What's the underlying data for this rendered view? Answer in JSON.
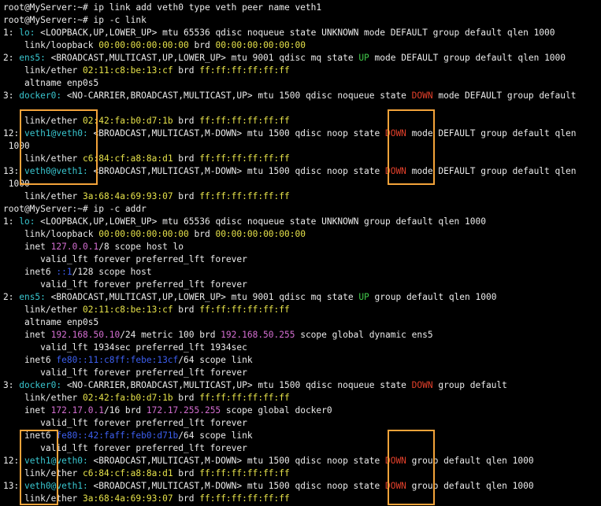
{
  "colors": {
    "background": "#000000",
    "text": "#ebebeb",
    "mac": "#e6e24a",
    "iface": "#39c6cf",
    "ipv4": "#d46ed1",
    "ipv6": "#3d5ff0",
    "up": "#41c94a",
    "down": "#e3402b",
    "highlight": "#f3a33a"
  },
  "terminal": {
    "lines": [
      [
        [
          "root@MyServer:~# ip link add veth0 type veth peer name veth1",
          ""
        ]
      ],
      [
        [
          "root@MyServer:~# ip -c link",
          ""
        ]
      ],
      [
        [
          "1: ",
          ""
        ],
        [
          "lo:",
          "c"
        ],
        [
          " <LOOPBACK,UP,LOWER_UP> mtu 65536 qdisc noqueue state UNKNOWN mode DEFAULT group default qlen 1000",
          ""
        ]
      ],
      [
        [
          "    link/loopback ",
          ""
        ],
        [
          "00:00:00:00:00:00",
          "y"
        ],
        [
          " brd ",
          ""
        ],
        [
          "00:00:00:00:00:00",
          "y"
        ]
      ],
      [
        [
          "2: ",
          ""
        ],
        [
          "ens5:",
          "c"
        ],
        [
          " <BROADCAST,MULTICAST,UP,LOWER_UP> mtu 9001 qdisc mq state ",
          ""
        ],
        [
          "UP",
          "g"
        ],
        [
          " mode DEFAULT group default qlen 1000",
          ""
        ]
      ],
      [
        [
          "    link/ether ",
          ""
        ],
        [
          "02:11:c8:be:13:cf",
          "y"
        ],
        [
          " brd ",
          ""
        ],
        [
          "ff:ff:ff:ff:ff:ff",
          "y"
        ]
      ],
      [
        [
          "    altname enp0s5",
          ""
        ]
      ],
      [
        [
          "3: ",
          ""
        ],
        [
          "docker0:",
          "c"
        ],
        [
          " <NO-CARRIER,BROADCAST,MULTICAST,UP> mtu 1500 qdisc noqueue state ",
          ""
        ],
        [
          "DOWN",
          "r"
        ],
        [
          " mode DEFAULT group default",
          ""
        ]
      ],
      [],
      [
        [
          "    link/ether ",
          ""
        ],
        [
          "02:42:fa:b0:d7:1b",
          "y"
        ],
        [
          " brd ",
          ""
        ],
        [
          "ff:ff:ff:ff:ff:ff",
          "y"
        ]
      ],
      [
        [
          "12: ",
          ""
        ],
        [
          "veth1@veth0:",
          "c"
        ],
        [
          " <BROADCAST,MULTICAST,M-DOWN> mtu 1500 qdisc noop state ",
          ""
        ],
        [
          "DOWN",
          "r"
        ],
        [
          " mode DEFAULT group default qlen",
          ""
        ]
      ],
      [
        [
          " 1000",
          ""
        ]
      ],
      [
        [
          "    link/ether ",
          ""
        ],
        [
          "c6:84:cf:a8:8a:d1",
          "y"
        ],
        [
          " brd ",
          ""
        ],
        [
          "ff:ff:ff:ff:ff:ff",
          "y"
        ]
      ],
      [
        [
          "13: ",
          ""
        ],
        [
          "veth0@veth1:",
          "c"
        ],
        [
          " <BROADCAST,MULTICAST,M-DOWN> mtu 1500 qdisc noop state ",
          ""
        ],
        [
          "DOWN",
          "r"
        ],
        [
          " mode DEFAULT group default qlen",
          ""
        ]
      ],
      [
        [
          " 1000",
          ""
        ]
      ],
      [
        [
          "    link/ether ",
          ""
        ],
        [
          "3a:68:4a:69:93:07",
          "y"
        ],
        [
          " brd ",
          ""
        ],
        [
          "ff:ff:ff:ff:ff:ff",
          "y"
        ]
      ],
      [
        [
          "root@MyServer:~# ip -c addr",
          ""
        ]
      ],
      [
        [
          "1: ",
          ""
        ],
        [
          "lo:",
          "c"
        ],
        [
          " <LOOPBACK,UP,LOWER_UP> mtu 65536 qdisc noqueue state UNKNOWN group default qlen 1000",
          ""
        ]
      ],
      [
        [
          "    link/loopback ",
          ""
        ],
        [
          "00:00:00:00:00:00",
          "y"
        ],
        [
          " brd ",
          ""
        ],
        [
          "00:00:00:00:00:00",
          "y"
        ]
      ],
      [
        [
          "    inet ",
          ""
        ],
        [
          "127.0.0.1",
          "m"
        ],
        [
          "/8 scope host lo",
          ""
        ]
      ],
      [
        [
          "       valid_lft forever preferred_lft forever",
          ""
        ]
      ],
      [
        [
          "    inet6 ",
          ""
        ],
        [
          "::1",
          "b"
        ],
        [
          "/128 scope host",
          ""
        ]
      ],
      [
        [
          "       valid_lft forever preferred_lft forever",
          ""
        ]
      ],
      [
        [
          "2: ",
          ""
        ],
        [
          "ens5:",
          "c"
        ],
        [
          " <BROADCAST,MULTICAST,UP,LOWER_UP> mtu 9001 qdisc mq state ",
          ""
        ],
        [
          "UP",
          "g"
        ],
        [
          " group default qlen 1000",
          ""
        ]
      ],
      [
        [
          "    link/ether ",
          ""
        ],
        [
          "02:11:c8:be:13:cf",
          "y"
        ],
        [
          " brd ",
          ""
        ],
        [
          "ff:ff:ff:ff:ff:ff",
          "y"
        ]
      ],
      [
        [
          "    altname enp0s5",
          ""
        ]
      ],
      [
        [
          "    inet ",
          ""
        ],
        [
          "192.168.50.10",
          "m"
        ],
        [
          "/24 metric 100 brd ",
          ""
        ],
        [
          "192.168.50.255",
          "m"
        ],
        [
          " scope global dynamic ens5",
          ""
        ]
      ],
      [
        [
          "       valid_lft 1934sec preferred_lft 1934sec",
          ""
        ]
      ],
      [
        [
          "    inet6 ",
          ""
        ],
        [
          "fe80::11:c8ff:febe:13cf",
          "b"
        ],
        [
          "/64 scope link",
          ""
        ]
      ],
      [
        [
          "       valid_lft forever preferred_lft forever",
          ""
        ]
      ],
      [
        [
          "3: ",
          ""
        ],
        [
          "docker0:",
          "c"
        ],
        [
          " <NO-CARRIER,BROADCAST,MULTICAST,UP> mtu 1500 qdisc noqueue state ",
          ""
        ],
        [
          "DOWN",
          "r"
        ],
        [
          " group default",
          ""
        ]
      ],
      [
        [
          "    link/ether ",
          ""
        ],
        [
          "02:42:fa:b0:d7:1b",
          "y"
        ],
        [
          " brd ",
          ""
        ],
        [
          "ff:ff:ff:ff:ff:ff",
          "y"
        ]
      ],
      [
        [
          "    inet ",
          ""
        ],
        [
          "172.17.0.1",
          "m"
        ],
        [
          "/16 brd ",
          ""
        ],
        [
          "172.17.255.255",
          "m"
        ],
        [
          " scope global docker0",
          ""
        ]
      ],
      [
        [
          "       valid_lft forever preferred_lft forever",
          ""
        ]
      ],
      [
        [
          "    inet6 ",
          ""
        ],
        [
          "fe80::42:faff:feb0:d71b",
          "b"
        ],
        [
          "/64 scope link",
          ""
        ]
      ],
      [
        [
          "       valid_lft forever preferred_lft forever",
          ""
        ]
      ],
      [
        [
          "12: ",
          ""
        ],
        [
          "veth1@veth0:",
          "c"
        ],
        [
          " <BROADCAST,MULTICAST,M-DOWN> mtu 1500 qdisc noop state ",
          ""
        ],
        [
          "DOWN",
          "r"
        ],
        [
          " group default qlen 1000",
          ""
        ]
      ],
      [
        [
          "    link/ether ",
          ""
        ],
        [
          "c6:84:cf:a8:8a:d1",
          "y"
        ],
        [
          " brd ",
          ""
        ],
        [
          "ff:ff:ff:ff:ff:ff",
          "y"
        ]
      ],
      [
        [
          "13: ",
          ""
        ],
        [
          "veth0@veth1:",
          "c"
        ],
        [
          " <BROADCAST,MULTICAST,M-DOWN> mtu 1500 qdisc noop state ",
          ""
        ],
        [
          "DOWN",
          "r"
        ],
        [
          " group default qlen 1000",
          ""
        ]
      ],
      [
        [
          "    link/ether ",
          ""
        ],
        [
          "3a:68:4a:69:93:07",
          "y"
        ],
        [
          " brd ",
          ""
        ],
        [
          "ff:ff:ff:ff:ff:ff",
          "y"
        ]
      ]
    ]
  }
}
